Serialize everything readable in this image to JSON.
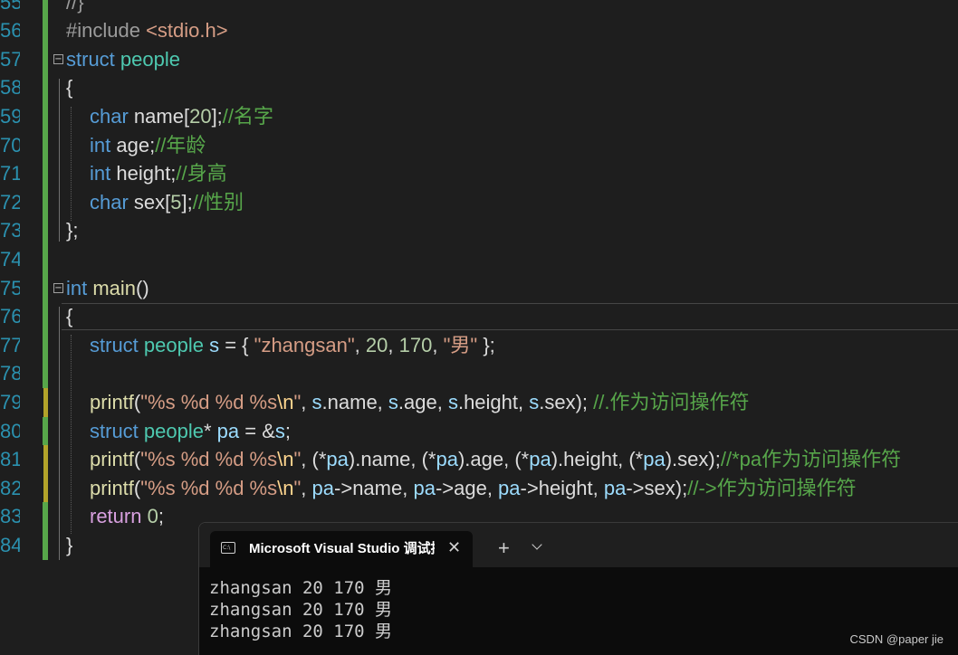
{
  "editor": {
    "lines": [
      {
        "no": "55",
        "indent": 0,
        "fold": false,
        "change": "saved",
        "tokens": [
          [
            "pp",
            "//}"
          ]
        ]
      },
      {
        "no": "56",
        "indent": 0,
        "fold": false,
        "change": "saved",
        "tokens": [
          [
            "pp",
            "#include "
          ],
          [
            "inc",
            "<stdio.h>"
          ]
        ]
      },
      {
        "no": "57",
        "indent": 0,
        "fold": true,
        "change": "saved",
        "tokens": [
          [
            "kw",
            "struct "
          ],
          [
            "ty",
            "people"
          ]
        ]
      },
      {
        "no": "58",
        "indent": 0,
        "fold": false,
        "change": "saved",
        "tokens": [
          [
            "pl",
            "{"
          ]
        ]
      },
      {
        "no": "59",
        "indent": 1,
        "fold": false,
        "change": "saved",
        "tokens": [
          [
            "kw",
            "char "
          ],
          [
            "pl",
            "name["
          ],
          [
            "num",
            "20"
          ],
          [
            "pl",
            "];"
          ],
          [
            "cm",
            "//名字"
          ]
        ]
      },
      {
        "no": "70",
        "indent": 1,
        "fold": false,
        "change": "saved",
        "tokens": [
          [
            "kw",
            "int "
          ],
          [
            "pl",
            "age;"
          ],
          [
            "cm",
            "//年龄"
          ]
        ]
      },
      {
        "no": "71",
        "indent": 1,
        "fold": false,
        "change": "saved",
        "tokens": [
          [
            "kw",
            "int "
          ],
          [
            "pl",
            "height;"
          ],
          [
            "cm",
            "//身高"
          ]
        ]
      },
      {
        "no": "72",
        "indent": 1,
        "fold": false,
        "change": "saved",
        "tokens": [
          [
            "kw",
            "char "
          ],
          [
            "pl",
            "sex["
          ],
          [
            "num",
            "5"
          ],
          [
            "pl",
            "];"
          ],
          [
            "cm",
            "//性别"
          ]
        ]
      },
      {
        "no": "73",
        "indent": 0,
        "fold": false,
        "change": "saved",
        "tokens": [
          [
            "pl",
            "};"
          ]
        ]
      },
      {
        "no": "74",
        "indent": 0,
        "fold": false,
        "change": "saved",
        "tokens": []
      },
      {
        "no": "75",
        "indent": 0,
        "fold": true,
        "change": "saved",
        "tokens": [
          [
            "kw",
            "int "
          ],
          [
            "fn",
            "main"
          ],
          [
            "pl",
            "()"
          ]
        ]
      },
      {
        "no": "76",
        "indent": 0,
        "fold": false,
        "change": "saved",
        "tokens": [
          [
            "pl",
            "{"
          ]
        ]
      },
      {
        "no": "77",
        "indent": 1,
        "fold": false,
        "change": "saved",
        "tokens": [
          [
            "kw",
            "struct "
          ],
          [
            "ty",
            "people "
          ],
          [
            "var",
            "s"
          ],
          [
            "pl",
            " = { "
          ],
          [
            "str",
            "\"zhangsan\""
          ],
          [
            "pl",
            ", "
          ],
          [
            "num",
            "20"
          ],
          [
            "pl",
            ", "
          ],
          [
            "num",
            "170"
          ],
          [
            "pl",
            ", "
          ],
          [
            "str",
            "\"男\""
          ],
          [
            "pl",
            " };"
          ]
        ]
      },
      {
        "no": "78",
        "indent": 1,
        "fold": false,
        "change": "saved",
        "tokens": []
      },
      {
        "no": "79",
        "indent": 1,
        "fold": false,
        "change": "unsaved",
        "tokens": [
          [
            "fn",
            "printf"
          ],
          [
            "pl",
            "("
          ],
          [
            "str",
            "\"%s %d %d %s"
          ],
          [
            "esc",
            "\\n"
          ],
          [
            "str",
            "\""
          ],
          [
            "pl",
            ", "
          ],
          [
            "var",
            "s"
          ],
          [
            "pl",
            ".name, "
          ],
          [
            "var",
            "s"
          ],
          [
            "pl",
            ".age, "
          ],
          [
            "var",
            "s"
          ],
          [
            "pl",
            ".height, "
          ],
          [
            "var",
            "s"
          ],
          [
            "pl",
            ".sex); "
          ],
          [
            "cm",
            "//.作为访问操作符"
          ]
        ]
      },
      {
        "no": "80",
        "indent": 1,
        "fold": false,
        "change": "saved",
        "tokens": [
          [
            "kw",
            "struct "
          ],
          [
            "ty",
            "people"
          ],
          [
            "pl",
            "* "
          ],
          [
            "var",
            "pa"
          ],
          [
            "pl",
            " = &"
          ],
          [
            "var",
            "s"
          ],
          [
            "pl",
            ";"
          ]
        ]
      },
      {
        "no": "81",
        "indent": 1,
        "fold": false,
        "change": "unsaved",
        "tokens": [
          [
            "fn",
            "printf"
          ],
          [
            "pl",
            "("
          ],
          [
            "str",
            "\"%s %d %d %s"
          ],
          [
            "esc",
            "\\n"
          ],
          [
            "str",
            "\""
          ],
          [
            "pl",
            ", (*"
          ],
          [
            "var",
            "pa"
          ],
          [
            "pl",
            ").name, (*"
          ],
          [
            "var",
            "pa"
          ],
          [
            "pl",
            ").age, (*"
          ],
          [
            "var",
            "pa"
          ],
          [
            "pl",
            ").height, (*"
          ],
          [
            "var",
            "pa"
          ],
          [
            "pl",
            ").sex);"
          ],
          [
            "cm",
            "//*pa作为访问操作符"
          ]
        ]
      },
      {
        "no": "82",
        "indent": 1,
        "fold": false,
        "change": "unsaved",
        "tokens": [
          [
            "fn",
            "printf"
          ],
          [
            "pl",
            "("
          ],
          [
            "str",
            "\"%s %d %d %s"
          ],
          [
            "esc",
            "\\n"
          ],
          [
            "str",
            "\""
          ],
          [
            "pl",
            ", "
          ],
          [
            "var",
            "pa"
          ],
          [
            "pl",
            "->name, "
          ],
          [
            "var",
            "pa"
          ],
          [
            "pl",
            "->age, "
          ],
          [
            "var",
            "pa"
          ],
          [
            "pl",
            "->height, "
          ],
          [
            "var",
            "pa"
          ],
          [
            "pl",
            "->sex);"
          ],
          [
            "cm",
            "//->作为访问操作符"
          ]
        ]
      },
      {
        "no": "83",
        "indent": 1,
        "fold": false,
        "change": "saved",
        "tokens": [
          [
            "ctl",
            "return "
          ],
          [
            "num",
            "0"
          ],
          [
            "pl",
            ";"
          ]
        ]
      },
      {
        "no": "84",
        "indent": 0,
        "fold": false,
        "change": "saved",
        "tokens": [
          [
            "pl",
            "}"
          ]
        ]
      }
    ]
  },
  "terminal": {
    "tab_title": "Microsoft Visual Studio 调试控制台",
    "icon": "console-icon",
    "icon_glyph": "C:\\",
    "close_glyph": "✕",
    "new_tab_glyph": "+",
    "output": [
      "zhangsan 20 170 男",
      "zhangsan 20 170 男",
      "zhangsan 20 170 男"
    ]
  },
  "watermark": "CSDN @paper jie"
}
